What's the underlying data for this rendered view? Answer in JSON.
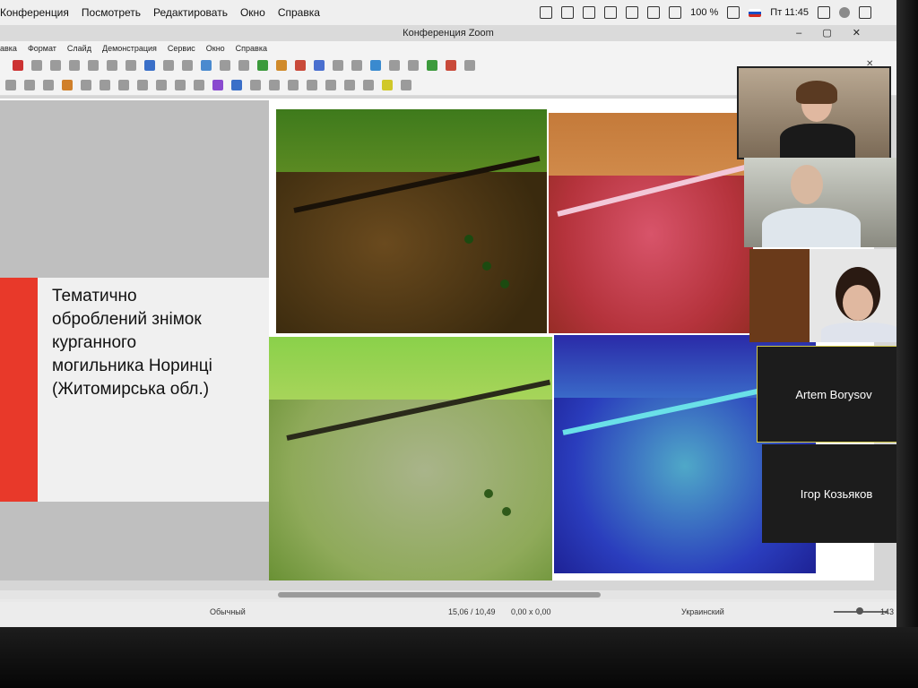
{
  "menubar": {
    "items": [
      "Конференция",
      "Посмотреть",
      "Редактировать",
      "Окно",
      "Справка"
    ],
    "battery": "100 %",
    "clock": "Пт 11:45"
  },
  "window": {
    "title": "Конференция Zoom"
  },
  "appmenu": {
    "items": [
      "авка",
      "Формат",
      "Слайд",
      "Демонстрация",
      "Сервис",
      "Окно",
      "Справка"
    ]
  },
  "slide": {
    "title": "Тематично\nоброблений знімок\nкурганного\nмогильника Норинці\n(Житомирська обл.)"
  },
  "status": {
    "layout": "Обычный",
    "position": "15,06 / 10,49",
    "size": "0,00 x 0,00",
    "language": "Украинский",
    "zoom": "143"
  },
  "participants": {
    "named": [
      "Artem Borysov",
      "Ігор Козьяков"
    ]
  },
  "colors": {
    "accent_red": "#e8392a",
    "active_speaker_border": "#d0c84a"
  }
}
